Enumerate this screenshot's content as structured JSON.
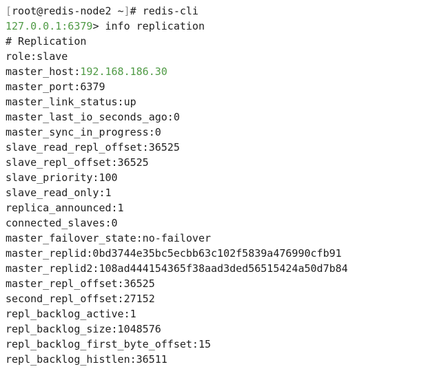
{
  "terminal": {
    "partial_top_line": "          -  -     --  -    ",
    "prompt1": {
      "open_bracket": "[",
      "user_host": "root@redis-node2 ~",
      "close_bracket": "]",
      "symbol": "# ",
      "command": "redis-cli"
    },
    "prompt2": {
      "address": "127.0.0.1:6379",
      "symbol": "> ",
      "command": "info replication"
    },
    "section_header": "# Replication",
    "output": {
      "role": "role:slave",
      "master_host_key": "master_host:",
      "master_host_value": "192.168.186.30",
      "lines": [
        "master_port:6379",
        "master_link_status:up",
        "master_last_io_seconds_ago:0",
        "master_sync_in_progress:0",
        "slave_read_repl_offset:36525",
        "slave_repl_offset:36525",
        "slave_priority:100",
        "slave_read_only:1",
        "replica_announced:1",
        "connected_slaves:0",
        "master_failover_state:no-failover",
        "master_replid:0bd3744e35bc5ecbb63c102f5839a476990cfb91",
        "master_replid2:108ad444154365f38aad3ded56515424a50d7b84",
        "master_repl_offset:36525",
        "second_repl_offset:27152",
        "repl_backlog_active:1",
        "repl_backlog_size:1048576",
        "repl_backlog_first_byte_offset:15",
        "repl_backlog_histlen:36511"
      ]
    }
  },
  "colors": {
    "background": "#ffffff",
    "text": "#1f1f1f",
    "green": "#4f9a45",
    "bracket_gray": "#888888"
  }
}
